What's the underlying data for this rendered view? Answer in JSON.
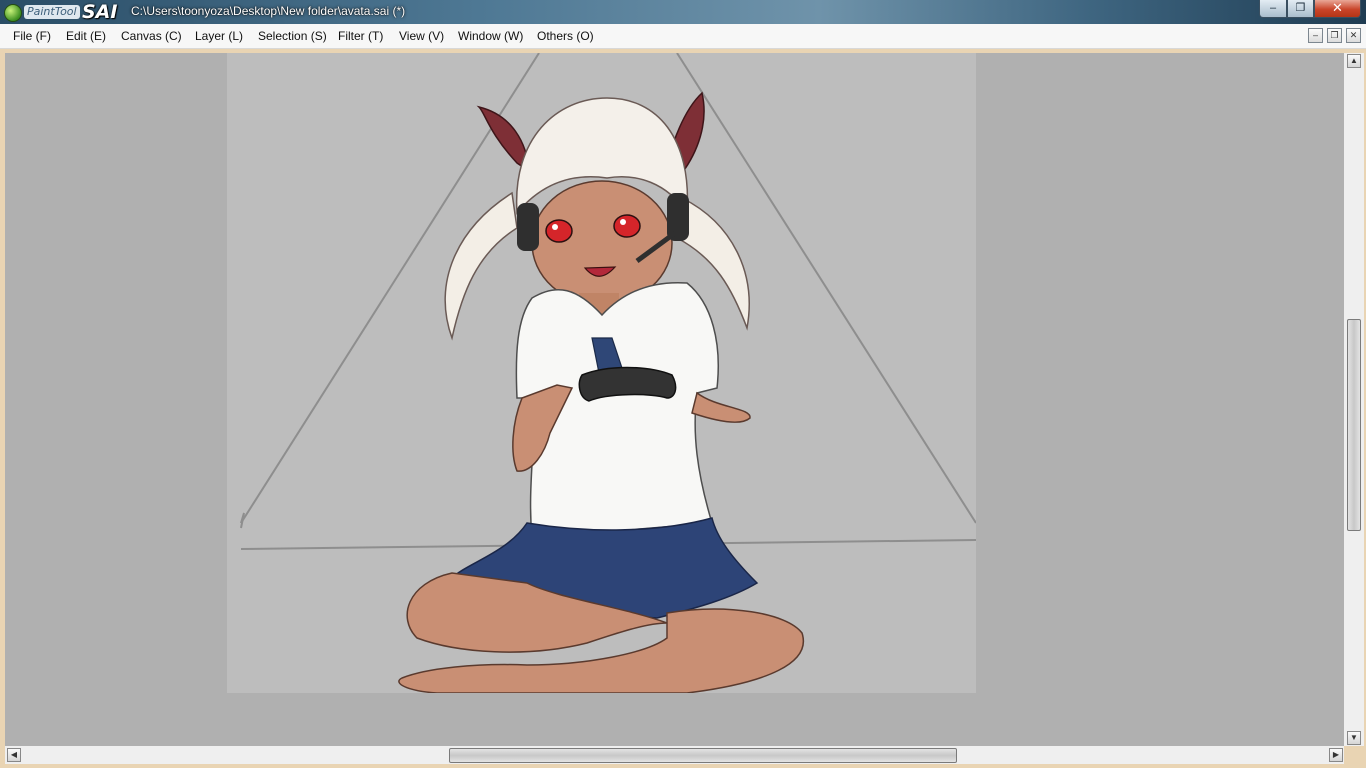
{
  "window": {
    "app_name_part1": "PaintTool",
    "app_name_part2": "SAI",
    "title": "C:\\Users\\toonyoza\\Desktop\\New folder\\avata.sai (*)",
    "controls": {
      "minimize": "–",
      "maximize": "❐",
      "close": "✕"
    }
  },
  "menubar": {
    "items": [
      {
        "label": "File (F)"
      },
      {
        "label": "Edit (E)"
      },
      {
        "label": "Canvas (C)"
      },
      {
        "label": "Layer (L)"
      },
      {
        "label": "Selection (S)"
      },
      {
        "label": "Filter (T)"
      },
      {
        "label": "View (V)"
      },
      {
        "label": "Window (W)"
      },
      {
        "label": "Others (O)"
      }
    ],
    "mdi_controls": {
      "minimize": "–",
      "restore": "❐",
      "close": "✕"
    }
  },
  "scrollbars": {
    "up": "▲",
    "down": "▼",
    "left": "◀",
    "right": "▶"
  },
  "colors": {
    "canvas_bg": "#bdbdbd",
    "workspace_bg": "#b0b0b0",
    "frame": "#e9d4b3"
  },
  "icons": [
    "painttool-sai-logo-icon",
    "minimize-icon",
    "maximize-icon",
    "close-icon",
    "scroll-up-icon",
    "scroll-down-icon",
    "scroll-left-icon",
    "scroll-right-icon"
  ]
}
